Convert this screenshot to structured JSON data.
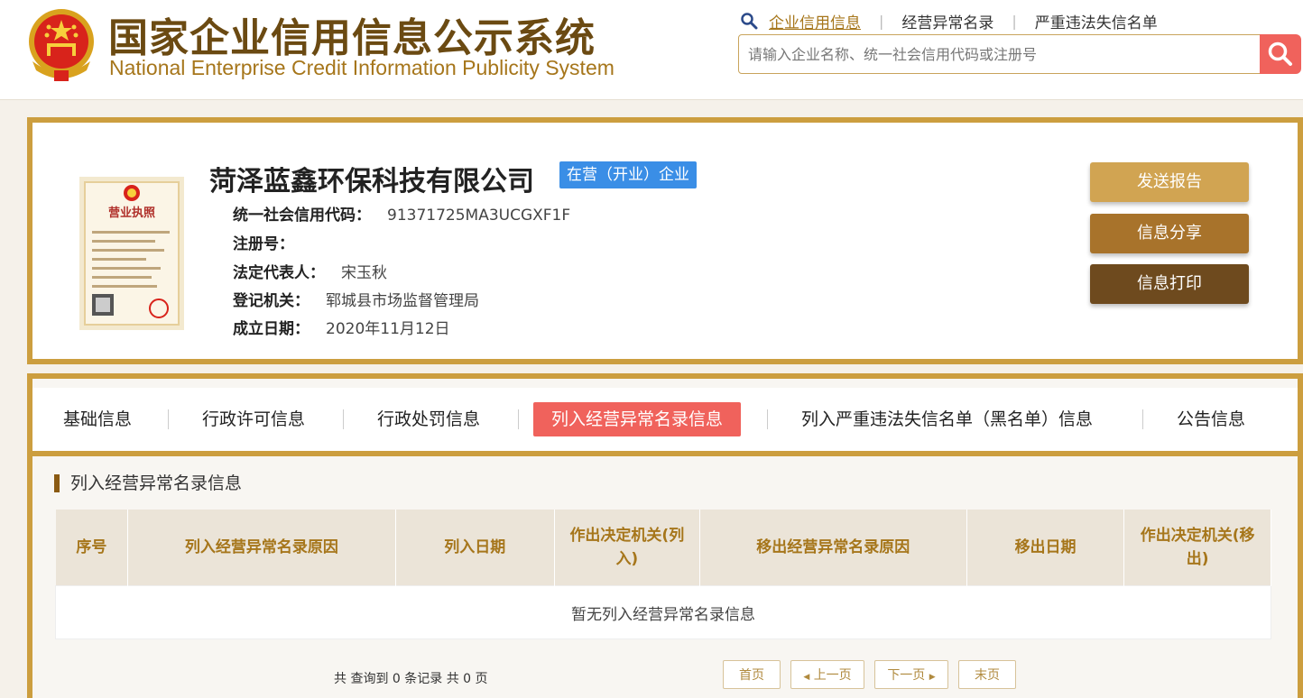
{
  "header": {
    "title_cn": "国家企业信用信息公示系统",
    "title_en": "National Enterprise Credit Information Publicity System",
    "nav": [
      {
        "label": "企业信用信息"
      },
      {
        "label": "经营异常名录"
      },
      {
        "label": "严重违法失信名单"
      }
    ],
    "search": {
      "placeholder": "请输入企业名称、统一社会信用代码或注册号",
      "value": ""
    }
  },
  "company": {
    "name": "菏泽蓝鑫环保科技有限公司",
    "status": "在营（开业）企业",
    "fields": [
      {
        "label": "统一社会信用代码：",
        "value": "91371725MA3UCGXF1F"
      },
      {
        "label": "注册号：",
        "value": ""
      },
      {
        "label": "法定代表人：",
        "value": "宋玉秋"
      },
      {
        "label": "登记机关：",
        "value": "郓城县市场监督管理局"
      },
      {
        "label": "成立日期：",
        "value": "2020年11月12日"
      }
    ],
    "license_title": "营业执照"
  },
  "actions": {
    "send_report": "发送报告",
    "share": "信息分享",
    "print": "信息打印"
  },
  "colors": {
    "gold_border": "#cc9e3f",
    "brand_brown": "#6b4a12",
    "accent_red": "#f0625c",
    "badge_blue": "#3a8ee6"
  },
  "tabs": [
    {
      "label": "基础信息"
    },
    {
      "label": "行政许可信息"
    },
    {
      "label": "行政处罚信息"
    },
    {
      "label": "列入经营异常名录信息"
    },
    {
      "label": "列入严重违法失信名单（黑名单）信息"
    },
    {
      "label": "公告信息"
    }
  ],
  "section": {
    "title": "列入经营异常名录信息",
    "columns": [
      "序号",
      "列入经营异常名录原因",
      "列入日期",
      "作出决定机关(列入)",
      "移出经营异常名录原因",
      "移出日期",
      "作出决定机关(移出)"
    ],
    "empty_text": "暂无列入经营异常名录信息"
  },
  "pager": {
    "summary": "共 查询到 0 条记录 共 0 页",
    "first": "首页",
    "prev": "上一页",
    "next": "下一页",
    "last": "末页"
  }
}
